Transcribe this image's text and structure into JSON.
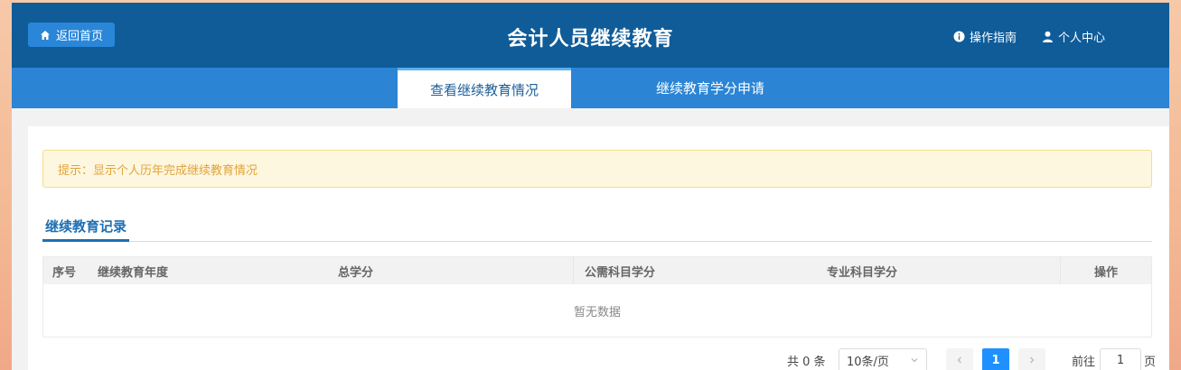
{
  "header": {
    "back_label": "返回首页",
    "title": "会计人员继续教育",
    "guide_label": "操作指南",
    "profile_label": "个人中心"
  },
  "tabs": [
    {
      "label": "查看继续教育情况",
      "active": true
    },
    {
      "label": "继续教育学分申请",
      "active": false
    }
  ],
  "notice": "提示：显示个人历年完成继续教育情况",
  "section_title": "继续教育记录",
  "table": {
    "columns": [
      "序号",
      "继续教育年度",
      "总学分",
      "公需科目学分",
      "专业科目学分",
      "操作"
    ],
    "empty_text": "暂无数据"
  },
  "pagination": {
    "total": "共 0 条",
    "page_size": "10条/页",
    "current_page": "1",
    "goto_prefix": "前往",
    "goto_value": "1",
    "goto_suffix": "页"
  },
  "colors": {
    "header_bg": "#0f5c99",
    "tabbar_bg": "#2b84d4",
    "accent": "#1e90ff",
    "notice_text": "#e0a33a"
  }
}
